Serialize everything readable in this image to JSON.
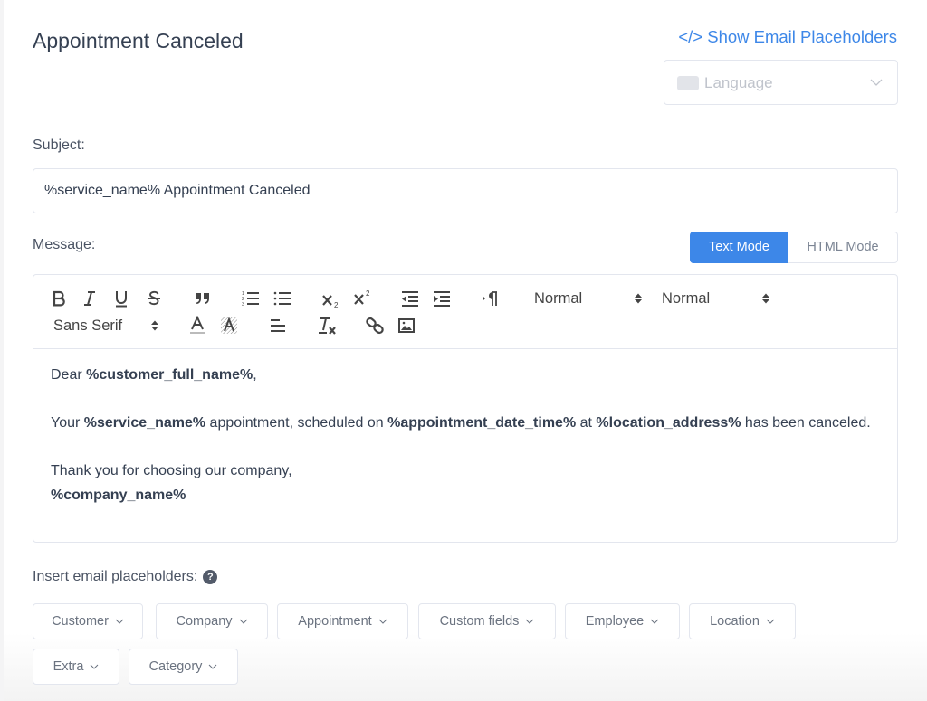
{
  "header": {
    "title": "Appointment Canceled",
    "show_placeholders_label": "</> Show Email Placeholders",
    "language_placeholder": "Language"
  },
  "subject": {
    "label": "Subject:",
    "value": "%service_name% Appointment Canceled"
  },
  "message": {
    "label": "Message:",
    "modes": [
      {
        "label": "Text Mode",
        "active": true
      },
      {
        "label": "HTML Mode",
        "active": false
      }
    ],
    "toolbar": {
      "icons": [
        "bold-icon",
        "italic-icon",
        "underline-icon",
        "strikethrough-icon",
        "blockquote-icon",
        "ordered-list-icon",
        "bullet-list-icon",
        "subscript-icon",
        "superscript-icon",
        "outdent-icon",
        "indent-icon",
        "text-direction-icon",
        "font-color-icon",
        "background-color-icon",
        "align-icon",
        "clear-formatting-icon",
        "link-icon",
        "image-icon"
      ],
      "size_select": "Normal",
      "header_select": "Normal",
      "font_select": "Sans Serif"
    },
    "body": {
      "line1_prefix": "Dear ",
      "line1_ph": "%customer_full_name%",
      "line1_suffix": ",",
      "line2_a": "Your ",
      "line2_ph1": "%service_name%",
      "line2_b": " appointment, scheduled on ",
      "line2_ph2": "%appointment_date_time%",
      "line2_c": " at ",
      "line2_ph3": "%location_address%",
      "line2_d": " has been canceled.",
      "line3": "Thank you for choosing our company,",
      "line4_ph": "%company_name%"
    }
  },
  "placeholders": {
    "label": "Insert email placeholders:",
    "help": "?",
    "buttons": [
      "Customer",
      "Company",
      "Appointment",
      "Custom fields",
      "Employee",
      "Location",
      "Extra",
      "Category"
    ]
  },
  "colors": {
    "accent": "#3d87e8",
    "text": "#354052",
    "border": "#e3e6ee"
  }
}
